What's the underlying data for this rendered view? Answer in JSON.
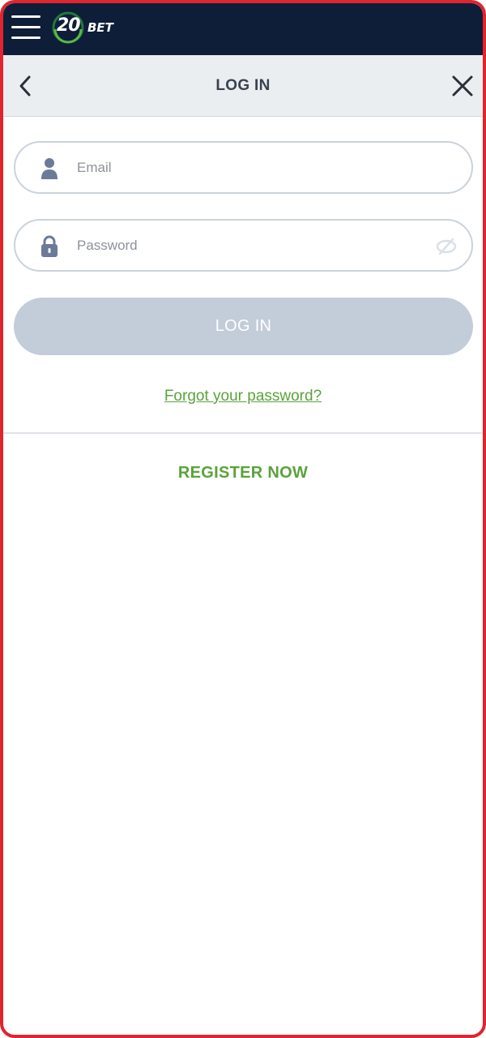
{
  "topbar": {
    "logo_number": "20",
    "logo_text": "BET",
    "icons": [
      "hamburger-menu-icon",
      "logo-globe-icon"
    ]
  },
  "header": {
    "title": "LOG IN",
    "back_icon": "chevron-left-icon",
    "close_icon": "close-icon"
  },
  "form": {
    "email": {
      "placeholder": "Email",
      "value": "",
      "icon": "user-icon"
    },
    "password": {
      "placeholder": "Password",
      "value": "",
      "icon": "lock-icon",
      "toggle_icon": "eye-off-icon"
    },
    "login_label": "LOG IN",
    "forgot_label": "Forgot your password?"
  },
  "register": {
    "label": "REGISTER NOW"
  },
  "colors": {
    "topbar_bg": "#0e1d38",
    "header_bg": "#ebeef1",
    "accent_green": "#5aa33a",
    "button_disabled": "#c3ccd9",
    "frame_border": "#e0252f"
  }
}
